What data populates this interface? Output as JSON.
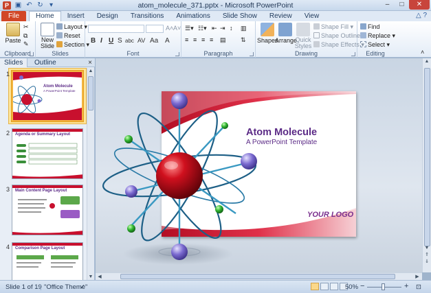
{
  "window": {
    "app_icon": "P",
    "title": "atom_molecule_371.pptx - Microsoft PowerPoint",
    "quick_access": [
      "save-icon",
      "undo-icon",
      "redo-icon"
    ]
  },
  "tabs": {
    "file": "File",
    "items": [
      "Home",
      "Insert",
      "Design",
      "Transitions",
      "Animations",
      "Slide Show",
      "Review",
      "View"
    ],
    "active": "Home"
  },
  "ribbon": {
    "clipboard": {
      "paste": "Paste",
      "label": "Clipboard"
    },
    "slides": {
      "new_slide_1": "New",
      "new_slide_2": "Slide",
      "layout": "Layout",
      "reset": "Reset",
      "section": "Section",
      "label": "Slides"
    },
    "font": {
      "bold": "B",
      "italic": "I",
      "underline": "U",
      "strike": "S",
      "shadow": "abc",
      "spacing": "AV",
      "case": "Aa",
      "color": "A",
      "label": "Font"
    },
    "paragraph": {
      "label": "Paragraph"
    },
    "drawing": {
      "shapes": "Shapes",
      "arrange": "Arrange",
      "quick_styles_1": "Quick",
      "quick_styles_2": "Styles",
      "shape_fill": "Shape Fill",
      "shape_outline": "Shape Outline",
      "shape_effects": "Shape Effects",
      "label": "Drawing"
    },
    "editing": {
      "find": "Find",
      "replace": "Replace",
      "select": "Select",
      "label": "Editing"
    }
  },
  "left_pane": {
    "tabs": [
      "Slides",
      "Outline"
    ],
    "active": "Slides",
    "close": "×",
    "thumbnails": [
      {
        "num": "1",
        "title": "Atom Molecule",
        "sub": "A PowerPoint Template"
      },
      {
        "num": "2",
        "title": "Agenda or Summary Layout"
      },
      {
        "num": "3",
        "title": "Main Content Page Layout"
      },
      {
        "num": "4",
        "title": "Comparison Page Layout"
      }
    ]
  },
  "slide": {
    "title": "Atom Molecule",
    "subtitle": "A PowerPoint Template",
    "logo": "YOUR LOGO"
  },
  "status": {
    "slide_info": "Slide 1 of 19",
    "theme": "\"Office Theme\"",
    "zoom": "50%",
    "zoom_out": "−",
    "zoom_in": "+"
  },
  "colors": {
    "file_tab": "#d24726",
    "slide_title": "#5b2a86",
    "accent_red": "#c8102e"
  }
}
